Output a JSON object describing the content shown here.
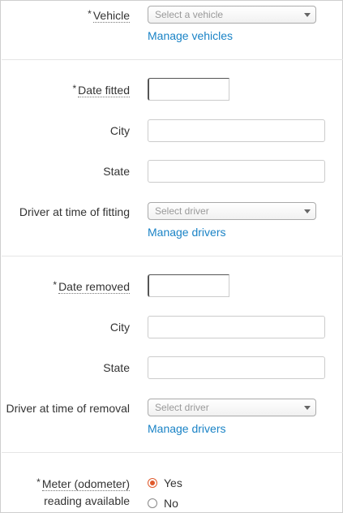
{
  "vehicle": {
    "label": "Vehicle",
    "required_mark": "*",
    "select_placeholder": "Select a vehicle",
    "manage_link": "Manage vehicles"
  },
  "fitting": {
    "date_label": "Date fitted",
    "date_required_mark": "*",
    "date_value": "",
    "city_label": "City",
    "city_value": "",
    "state_label": "State",
    "state_value": "",
    "driver_label": "Driver at time of fitting",
    "driver_select_placeholder": "Select driver",
    "manage_link": "Manage drivers"
  },
  "removal": {
    "date_label": "Date removed",
    "date_required_mark": "*",
    "date_value": "",
    "city_label": "City",
    "city_value": "",
    "state_label": "State",
    "state_value": "",
    "driver_label": "Driver at time of removal",
    "driver_select_placeholder": "Select driver",
    "manage_link": "Manage drivers"
  },
  "meter": {
    "required_mark": "*",
    "label_line1": "Meter (odometer)",
    "label_line2": "reading available",
    "options": [
      {
        "label": "Yes",
        "checked": true
      },
      {
        "label": "No",
        "checked": false
      }
    ]
  },
  "colors": {
    "link": "#1a83c6",
    "radio_selected": "#e05a2c",
    "border": "#cccccc",
    "divider": "#e5e5e5"
  }
}
